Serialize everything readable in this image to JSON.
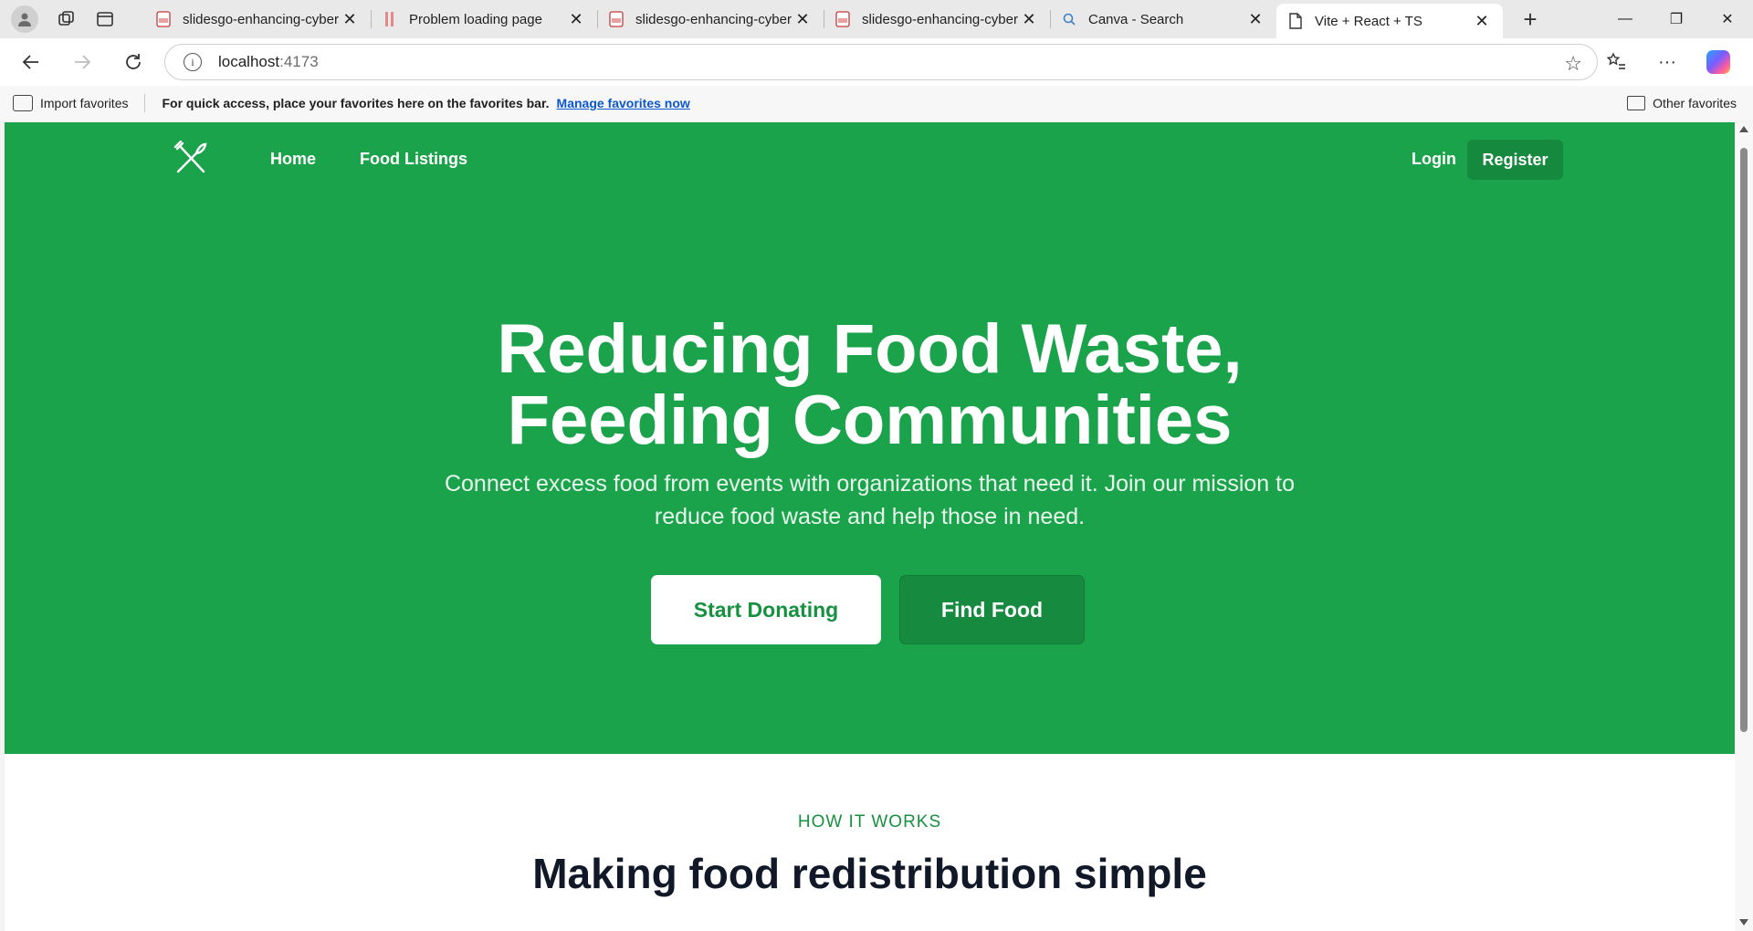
{
  "browser": {
    "tabs": [
      {
        "title": "slidesgo-enhancing-cyber",
        "icon": "pdf-icon",
        "active": false
      },
      {
        "title": "Problem loading page",
        "icon": "error-bars-icon",
        "active": false
      },
      {
        "title": "slidesgo-enhancing-cyber",
        "icon": "pdf-icon",
        "active": false
      },
      {
        "title": "slidesgo-enhancing-cyber",
        "icon": "pdf-icon",
        "active": false
      },
      {
        "title": "Canva - Search",
        "icon": "search-icon",
        "active": false
      },
      {
        "title": "Vite + React + TS",
        "icon": "page-icon",
        "active": true
      }
    ],
    "url": {
      "host": "localhost",
      "port": ":4173"
    },
    "favorites_bar": {
      "import_label": "Import favorites",
      "message": "For quick access, place your favorites here on the favorites bar.",
      "manage_link": "Manage favorites now",
      "other_label": "Other favorites"
    }
  },
  "page": {
    "nav": {
      "home": "Home",
      "listings": "Food Listings",
      "login": "Login",
      "register": "Register"
    },
    "hero": {
      "title_line1": "Reducing Food Waste,",
      "title_line2": "Feeding Communities",
      "subtitle": "Connect excess food from events with organizations that need it. Join our mission to reduce food waste and help those in need.",
      "cta_primary": "Start Donating",
      "cta_secondary": "Find Food"
    },
    "how_it_works": {
      "eyebrow": "HOW IT WORKS",
      "title": "Making food redistribution simple"
    },
    "colors": {
      "brand_green": "#1aa34a",
      "dark_green": "#158a3e",
      "heading_dark": "#111827"
    }
  }
}
